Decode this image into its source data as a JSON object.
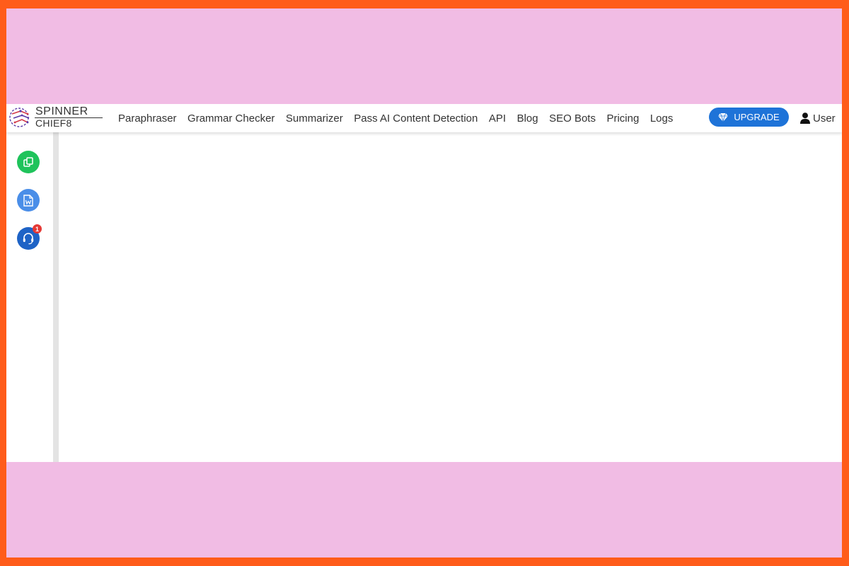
{
  "brand": {
    "line1": "SPINNER",
    "line2": "CHIEF8"
  },
  "nav": {
    "links": [
      "Paraphraser",
      "Grammar Checker",
      "Summarizer",
      "Pass AI Content Detection",
      "API",
      "Blog",
      "SEO Bots",
      "Pricing",
      "Logs"
    ]
  },
  "upgrade": {
    "label": "UPGRADE",
    "icon": "diamond-icon"
  },
  "user": {
    "label": "User",
    "icon": "user-icon"
  },
  "sidebar": {
    "buttons": [
      {
        "icon": "copy-icon",
        "color": "#1fc35b"
      },
      {
        "icon": "word-document-icon",
        "color": "#4a8ee8"
      },
      {
        "icon": "support-headset-icon",
        "color": "#1e63c6",
        "badge": "1"
      }
    ]
  },
  "colors": {
    "outer_border": "#ff5c1a",
    "frame_background": "#f1bce4",
    "accent": "#1e73d8"
  }
}
